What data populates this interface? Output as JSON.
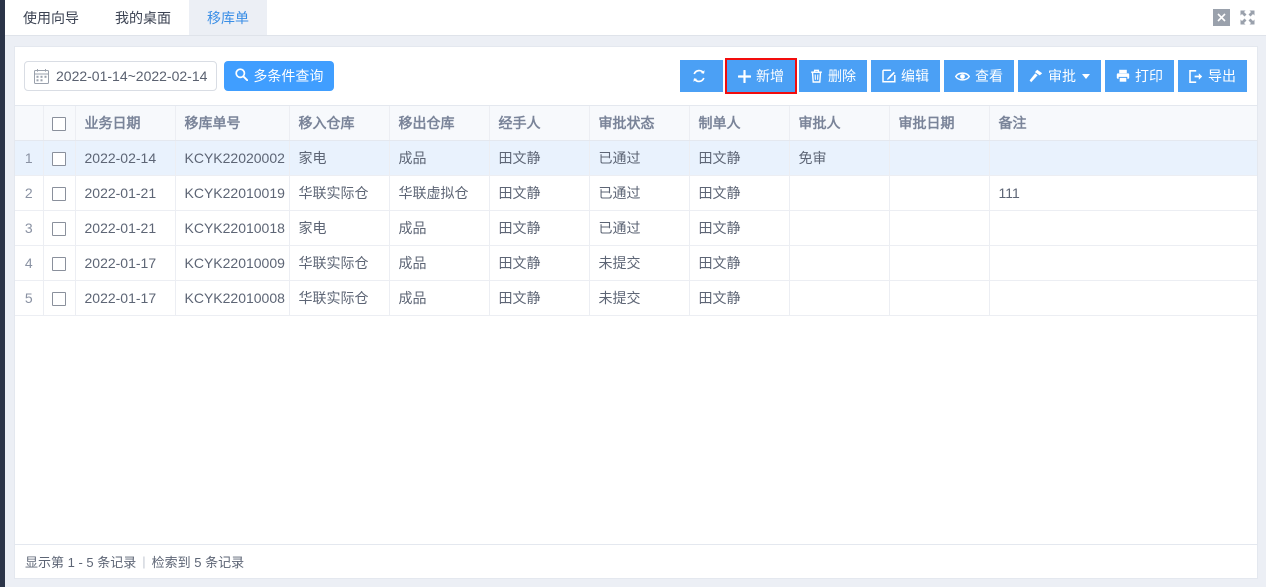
{
  "window": {
    "close_label": "×",
    "expand_label": "expand"
  },
  "tabs": [
    {
      "label": "使用向导",
      "active": false
    },
    {
      "label": "我的桌面",
      "active": false
    },
    {
      "label": "移库单",
      "active": true
    }
  ],
  "filter": {
    "date_range_value": "2022-01-14~2022-02-14",
    "query_label": "多条件查询"
  },
  "toolbar": {
    "refresh_label": "",
    "add_label": "新增",
    "delete_label": "删除",
    "edit_label": "编辑",
    "view_label": "查看",
    "approve_label": "审批",
    "print_label": "打印",
    "export_label": "导出",
    "highlight_color": "#f20d0d",
    "button_color": "#4ba0f5"
  },
  "table": {
    "columns": [
      "业务日期",
      "移库单号",
      "移入仓库",
      "移出仓库",
      "经手人",
      "审批状态",
      "制单人",
      "审批人",
      "审批日期",
      "备注"
    ],
    "rows": [
      {
        "index": "1",
        "selected": true,
        "cells": [
          "2022-02-14",
          "KCYK22020002",
          "家电",
          "成品",
          "田文静",
          "已通过",
          "田文静",
          "免审",
          "",
          ""
        ]
      },
      {
        "index": "2",
        "selected": false,
        "cells": [
          "2022-01-21",
          "KCYK22010019",
          "华联实际仓",
          "华联虚拟仓",
          "田文静",
          "已通过",
          "田文静",
          "",
          "",
          "111"
        ]
      },
      {
        "index": "3",
        "selected": false,
        "cells": [
          "2022-01-21",
          "KCYK22010018",
          "家电",
          "成品",
          "田文静",
          "已通过",
          "田文静",
          "",
          "",
          ""
        ]
      },
      {
        "index": "4",
        "selected": false,
        "cells": [
          "2022-01-17",
          "KCYK22010009",
          "华联实际仓",
          "成品",
          "田文静",
          "未提交",
          "田文静",
          "",
          "",
          ""
        ]
      },
      {
        "index": "5",
        "selected": false,
        "cells": [
          "2022-01-17",
          "KCYK22010008",
          "华联实际仓",
          "成品",
          "田文静",
          "未提交",
          "田文静",
          "",
          "",
          ""
        ]
      }
    ]
  },
  "footer": {
    "showing": "显示第 1 - 5 条记录",
    "separator": "|",
    "total": "检索到 5 条记录"
  }
}
